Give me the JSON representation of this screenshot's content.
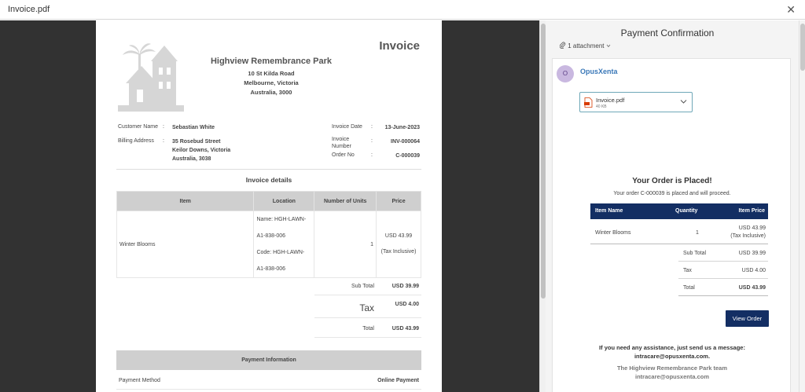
{
  "window": {
    "title": "Invoice.pdf",
    "close_glyph": "✕"
  },
  "invoice": {
    "title": "Invoice",
    "org_name": "Highview Remembrance Park",
    "org_address": [
      "10 St Kilda Road",
      "Melbourne, Victoria",
      "Australia, 3000"
    ],
    "customer_name_label": "Customer Name",
    "customer_name": "Sebastian White",
    "billing_address_label": "Billing Address",
    "billing_address": [
      "35 Rosebud Street",
      "Keilor Downs, Victoria",
      "Australia, 3038"
    ],
    "invoice_date_label": "Invoice Date",
    "invoice_date": "13-June-2023",
    "invoice_number_label": [
      "Invoice",
      "Number"
    ],
    "invoice_number": "INV-000064",
    "order_no_label": "Order No",
    "order_no": "C-000039",
    "colon": ":",
    "details_title": "Invoice details",
    "table_headers": [
      "Item",
      "Location",
      "Number of Units",
      "Price"
    ],
    "rows": [
      {
        "item": "Winter Blooms",
        "location": [
          "Name: HGH-LAWN-",
          "A1-838-006",
          "Code: HGH-LAWN-",
          "A1-838-006"
        ],
        "units": "1",
        "price": "USD 43.99",
        "price_note": "(Tax Inclusive)"
      }
    ],
    "subtotal_label": "Sub Total",
    "subtotal": "USD 39.99",
    "tax_label": "Tax",
    "tax": "USD 4.00",
    "total_label": "Total",
    "total": "USD 43.99",
    "payment_info_title": "Payment Information",
    "payment_method_label": "Payment Method",
    "payment_method": "Online Payment"
  },
  "email": {
    "subject": "Payment Confirmation",
    "attachment_count": "1 attachment",
    "sender_initial": "O",
    "sender": "OpusXenta",
    "file_name": "Invoice.pdf",
    "file_size": "40 KB",
    "heading": "Your Order is Placed!",
    "subheading": "Your order C-000039 is placed and will proceed.",
    "table_headers": [
      "Item Name",
      "Quantity",
      "Item Price"
    ],
    "item_name": "Winter Blooms",
    "item_qty": "1",
    "item_price": "USD 43.99",
    "item_price_note": "(Tax Inclusive)",
    "subtotal_label": "Sub Total",
    "subtotal": "USD 39.99",
    "tax_label": "Tax",
    "tax": "USD 4.00",
    "total_label": "Total",
    "total": "USD 43.99",
    "view_order_label": "View Order",
    "help_line1": "If you need any assistance, just send us a message:",
    "help_email": "intracare@opusxenta.com.",
    "team_line": "The Highview Remembrance Park team",
    "team_email": "intracare@opusxenta.com"
  },
  "colors": {
    "navy": "#132e63",
    "viewer_bg": "#323232",
    "link": "#3a78b8",
    "avatar": "#c9b8e0"
  },
  "icons": [
    "close-icon",
    "park-logo-icon",
    "paperclip-icon",
    "chevron-down-icon",
    "pdf-file-icon"
  ]
}
